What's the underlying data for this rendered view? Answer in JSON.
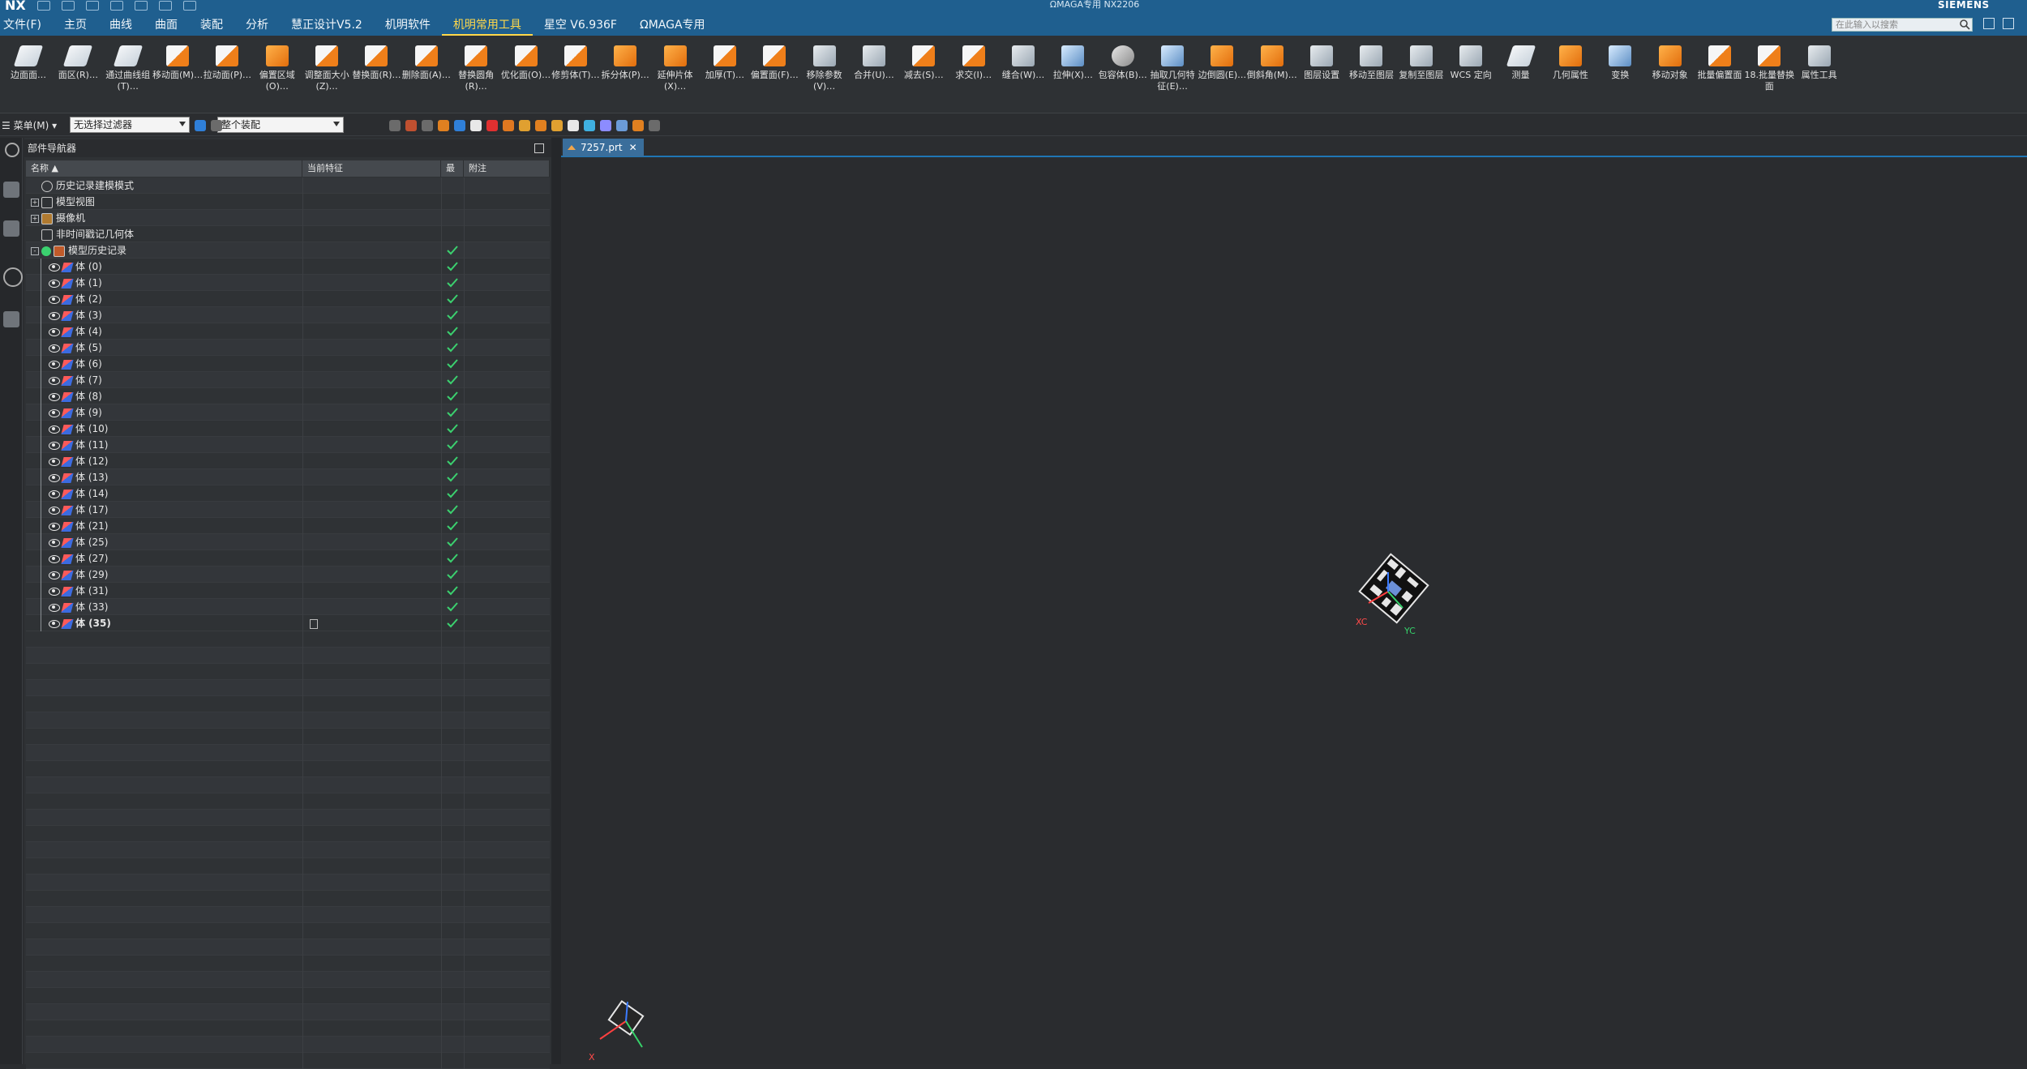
{
  "app": {
    "logo": "NX",
    "title": "ΩMAGA专用 NX2206",
    "brand": "SIEMENS"
  },
  "menus": [
    "文件(F)",
    "主页",
    "曲线",
    "曲面",
    "装配",
    "分析",
    "慧正设计V5.2",
    "机明软件",
    "机明常用工具",
    "星空 V6.936F",
    "ΩMAGA专用"
  ],
  "active_menu": "机明常用工具",
  "search": {
    "placeholder": "在此输入以搜索"
  },
  "ribbon": [
    {
      "label": "边面面…",
      "icon": "w"
    },
    {
      "label": "面区(R)…",
      "icon": "w"
    },
    {
      "label": "通过曲线组(T)…",
      "icon": "w"
    },
    {
      "label": "移动面(M)…",
      "icon": "wo"
    },
    {
      "label": "拉动面(P)…",
      "icon": "wo"
    },
    {
      "label": "偏置区域(O)…",
      "icon": "o"
    },
    {
      "label": "调整面大小(Z)…",
      "icon": "wo"
    },
    {
      "label": "替换面(R)…",
      "icon": "wo"
    },
    {
      "label": "删除面(A)…",
      "icon": "wo"
    },
    {
      "label": "替换圆角(R)…",
      "icon": "wo"
    },
    {
      "label": "优化面(O)…",
      "icon": "wo"
    },
    {
      "label": "修剪体(T)…",
      "icon": "wo"
    },
    {
      "label": "拆分体(P)…",
      "icon": "o"
    },
    {
      "label": "延伸片体(X)…",
      "icon": "o"
    },
    {
      "label": "加厚(T)…",
      "icon": "wo"
    },
    {
      "label": "偏置面(F)…",
      "icon": "wo"
    },
    {
      "label": "移除参数(V)…",
      "icon": "g"
    },
    {
      "label": "合并(U)…",
      "icon": "g"
    },
    {
      "label": "减去(S)…",
      "icon": "wo"
    },
    {
      "label": "求交(I)…",
      "icon": "wo"
    },
    {
      "label": "缝合(W)…",
      "icon": "g"
    },
    {
      "label": "拉伸(X)…",
      "icon": "b"
    },
    {
      "label": "包容体(B)…",
      "icon": "gr"
    },
    {
      "label": "抽取几何特征(E)…",
      "icon": "b"
    },
    {
      "label": "边倒圆(E)…",
      "icon": "o"
    },
    {
      "label": "倒斜角(M)…",
      "icon": "o"
    },
    {
      "label": "图层设置",
      "icon": "g"
    },
    {
      "label": "移动至图层",
      "icon": "g"
    },
    {
      "label": "复制至图层",
      "icon": "g"
    },
    {
      "label": "WCS 定向",
      "icon": "g"
    },
    {
      "label": "测量",
      "icon": "w"
    },
    {
      "label": "几何属性",
      "icon": "o"
    },
    {
      "label": "变换",
      "icon": "b"
    },
    {
      "label": "移动对象",
      "icon": "o"
    },
    {
      "label": "批量偏置面",
      "icon": "wo"
    },
    {
      "label": "18.批量替换面",
      "icon": "wo"
    },
    {
      "label": "属性工具",
      "icon": "g"
    }
  ],
  "selbar": {
    "menu_label": "菜单(M)",
    "filter_value": "无选择过滤器",
    "scope_value": "整个装配"
  },
  "navigator": {
    "title": "部件导航器",
    "columns": [
      "名称",
      "当前特征",
      "最",
      "附注"
    ],
    "rows": [
      {
        "label": "历史记录建模模式",
        "level": 0,
        "expander": "",
        "icon": "clock",
        "check": false
      },
      {
        "label": "模型视图",
        "level": 0,
        "expander": "+",
        "icon": "view",
        "check": false
      },
      {
        "label": "摄像机",
        "level": 0,
        "expander": "+",
        "icon": "camera",
        "check": false
      },
      {
        "label": "非时间戳记几何体",
        "level": 0,
        "expander": "",
        "icon": "folder",
        "check": false
      },
      {
        "label": "模型历史记录",
        "level": 0,
        "expander": "-",
        "icon": "history",
        "check": true
      },
      {
        "label": "体 (0)",
        "level": 1,
        "check": true
      },
      {
        "label": "体 (1)",
        "level": 1,
        "check": true
      },
      {
        "label": "体 (2)",
        "level": 1,
        "check": true
      },
      {
        "label": "体 (3)",
        "level": 1,
        "check": true
      },
      {
        "label": "体 (4)",
        "level": 1,
        "check": true
      },
      {
        "label": "体 (5)",
        "level": 1,
        "check": true
      },
      {
        "label": "体 (6)",
        "level": 1,
        "check": true
      },
      {
        "label": "体 (7)",
        "level": 1,
        "check": true
      },
      {
        "label": "体 (8)",
        "level": 1,
        "check": true
      },
      {
        "label": "体 (9)",
        "level": 1,
        "check": true
      },
      {
        "label": "体 (10)",
        "level": 1,
        "check": true
      },
      {
        "label": "体 (11)",
        "level": 1,
        "check": true
      },
      {
        "label": "体 (12)",
        "level": 1,
        "check": true
      },
      {
        "label": "体 (13)",
        "level": 1,
        "check": true
      },
      {
        "label": "体 (14)",
        "level": 1,
        "check": true
      },
      {
        "label": "体 (17)",
        "level": 1,
        "check": true
      },
      {
        "label": "体 (21)",
        "level": 1,
        "check": true
      },
      {
        "label": "体 (25)",
        "level": 1,
        "check": true
      },
      {
        "label": "体 (27)",
        "level": 1,
        "check": true
      },
      {
        "label": "体 (29)",
        "level": 1,
        "check": true
      },
      {
        "label": "体 (31)",
        "level": 1,
        "check": true
      },
      {
        "label": "体 (33)",
        "level": 1,
        "check": true
      },
      {
        "label": "体 (35)",
        "level": 1,
        "check": true,
        "current": true
      }
    ]
  },
  "graphics": {
    "tab_label": "7257.prt",
    "axis_labels": {
      "xc": "XC",
      "yc": "YC",
      "x": "X"
    }
  },
  "colors": {
    "titlebar": "#1f5f8f",
    "accent_tab": "#ffd84a",
    "check": "#3bd16f",
    "tab_active": "#3a6e9b"
  }
}
